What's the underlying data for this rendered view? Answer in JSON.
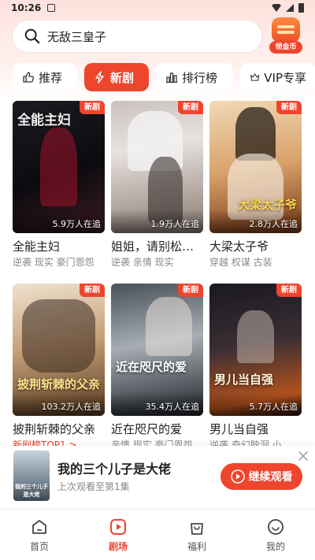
{
  "status_bar": {
    "time": "10:26"
  },
  "search": {
    "query": "无敌三皇子"
  },
  "coin": {
    "label": "领金币"
  },
  "tabs": [
    {
      "label": "推荐",
      "icon": "thumbs-up-icon"
    },
    {
      "label": "新剧",
      "icon": "lightning-icon"
    },
    {
      "label": "排行榜",
      "icon": "bar-chart-icon"
    },
    {
      "label": "VIP专享",
      "icon": "crown-icon"
    }
  ],
  "active_tab": "新剧",
  "badge_new": "新剧",
  "dramas": [
    {
      "title": "全能主妇",
      "watchers": "5.9万人在追",
      "tags": "逆袭 现实 豪门恩怨",
      "poster_title": "全能主妇",
      "colors": [
        "#0f0f14",
        "#3a1a1e"
      ]
    },
    {
      "title": "姐姐，请别松开我",
      "watchers": "1.9万人在追",
      "tags": "逆袭 亲情 现实",
      "poster_title": "",
      "colors": [
        "#d8d0cc",
        "#6b5a55"
      ]
    },
    {
      "title": "大梁太子爷",
      "watchers": "2.8万人在追",
      "tags": "穿越 权谋 古装",
      "poster_title": "大梁太子爷",
      "colors": [
        "#e9c69a",
        "#8a4a22"
      ]
    },
    {
      "title": "披荆斩棘的父亲",
      "watchers": "103.2万人在追",
      "tags": "新剧榜TOP1 >",
      "poster_title": "披荆斩棘的父亲",
      "colors": [
        "#c9b49a",
        "#5a3a20"
      ]
    },
    {
      "title": "近在咫尺的爱",
      "watchers": "35.4万人在追",
      "tags": "亲情 现实 豪门恩怨",
      "poster_title": "近在咫尺的爱",
      "colors": [
        "#7d8590",
        "#2c3038"
      ]
    },
    {
      "title": "男儿当自强",
      "watchers": "5.7万人在追",
      "tags": "逆袭 奇幻脑洞 小...",
      "poster_title": "男儿当自强",
      "colors": [
        "#2a2230",
        "#8a3a18"
      ]
    }
  ],
  "continue_watching": {
    "title": "我的三个儿子是大佬",
    "subtitle": "上次观看至第1集",
    "button": "继续观看"
  },
  "bottom_nav": [
    {
      "label": "首页",
      "icon": "home-icon"
    },
    {
      "label": "剧场",
      "icon": "play-icon"
    },
    {
      "label": "福利",
      "icon": "gift-bag-icon"
    },
    {
      "label": "我的",
      "icon": "profile-icon"
    }
  ],
  "accent_color": "#f0452d"
}
